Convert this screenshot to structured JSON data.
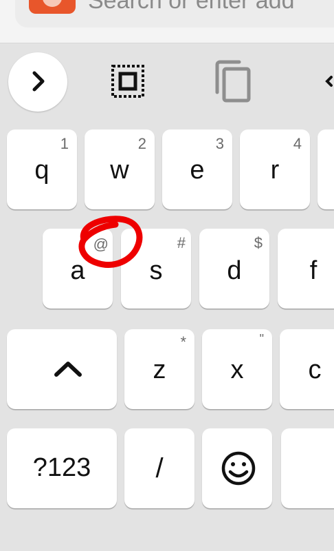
{
  "address_bar": {
    "placeholder": "Search or enter add"
  },
  "suggestion_toolbar": {
    "expand_icon": "chevron-right-icon",
    "select_all_icon": "select-all-icon",
    "copy_icon": "copy-icon",
    "more_icon": "chevron-left-icon"
  },
  "keyboard": {
    "row1": [
      {
        "label": "q",
        "hint": "1"
      },
      {
        "label": "w",
        "hint": "2"
      },
      {
        "label": "e",
        "hint": "3"
      },
      {
        "label": "r",
        "hint": "4"
      }
    ],
    "row2": [
      {
        "label": "a",
        "hint": "@"
      },
      {
        "label": "s",
        "hint": "#"
      },
      {
        "label": "d",
        "hint": "$"
      },
      {
        "label": "f",
        "hint": ""
      }
    ],
    "row3": [
      {
        "label": "z",
        "hint": "*"
      },
      {
        "label": "x",
        "hint": "\""
      },
      {
        "label": "c",
        "hint": ""
      }
    ],
    "row4": {
      "symbols_label": "?123",
      "slash_label": "/",
      "emoji_icon": "smiley-icon"
    },
    "shift_icon": "shift-up-icon"
  },
  "colors": {
    "keyboard_background": "#e3e3e3",
    "key_background": "#ffffff",
    "annotation": "#ee0000"
  }
}
